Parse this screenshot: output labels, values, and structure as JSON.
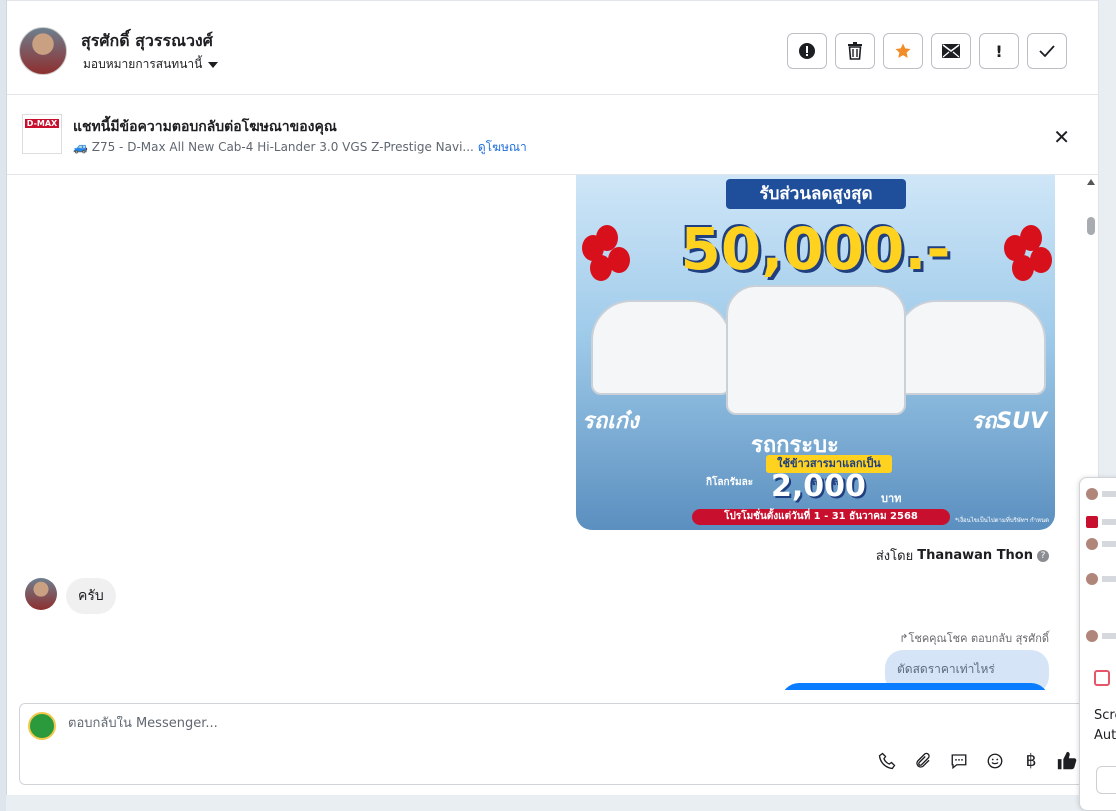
{
  "header": {
    "contact_name": "สุรศักดิ์ สุวรรณวงศ์",
    "assign_label": "มอบหมายการสนทนานี้",
    "actions": [
      {
        "name": "report-button",
        "icon": "!"
      },
      {
        "name": "delete-button",
        "icon": "🗑"
      },
      {
        "name": "star-button",
        "icon": "★"
      },
      {
        "name": "mark-unread-button",
        "icon": "✉"
      },
      {
        "name": "important-button",
        "icon": "!"
      },
      {
        "name": "mark-done-button",
        "icon": "✓"
      }
    ]
  },
  "ad_banner": {
    "title": "แชทนี้มีข้อความตอบกลับต่อโฆษณาของคุณ",
    "subtitle": "🚙 Z75 - D-Max All New Cab-4 Hi-Lander 3.0 VGS Z-Prestige Navi...",
    "link": "ดูโฆษณา",
    "thumb_text": "D-MAX"
  },
  "promo_image": {
    "banner": "รับส่วนลดสูงสุด",
    "amount": "50,000.-",
    "label_left": "รถเก๋ง",
    "label_right": "รถSUV",
    "label_mid": "รถกระบะ",
    "tag": "ใช้ข้าวสารมาแลกเป็นส่วนลด",
    "per_kg": "กิโลกรัมละ",
    "price": "2,000",
    "baht": "บาท",
    "date": "โปรโมชั่นตั้งแต่วันที่ 1 - 31 ธันวาคม 2568",
    "fine": "*เงื่อนไขเป็นไปตามที่บริษัทฯ กำหนด"
  },
  "messages": {
    "sent_by_prefix": "ส่งโดย",
    "sent_by_name": "Thanawan Thon",
    "incoming": "ครับ",
    "reply_meta": "↱โชคคุณโชค ตอบกลับ สุรศักดิ์",
    "quoted": "ตัดสดราคาเท่าไหร่"
  },
  "composer": {
    "placeholder": "ตอบกลับใน Messenger..."
  },
  "side_panel": {
    "text1": "Scre",
    "text2": "Aut"
  }
}
